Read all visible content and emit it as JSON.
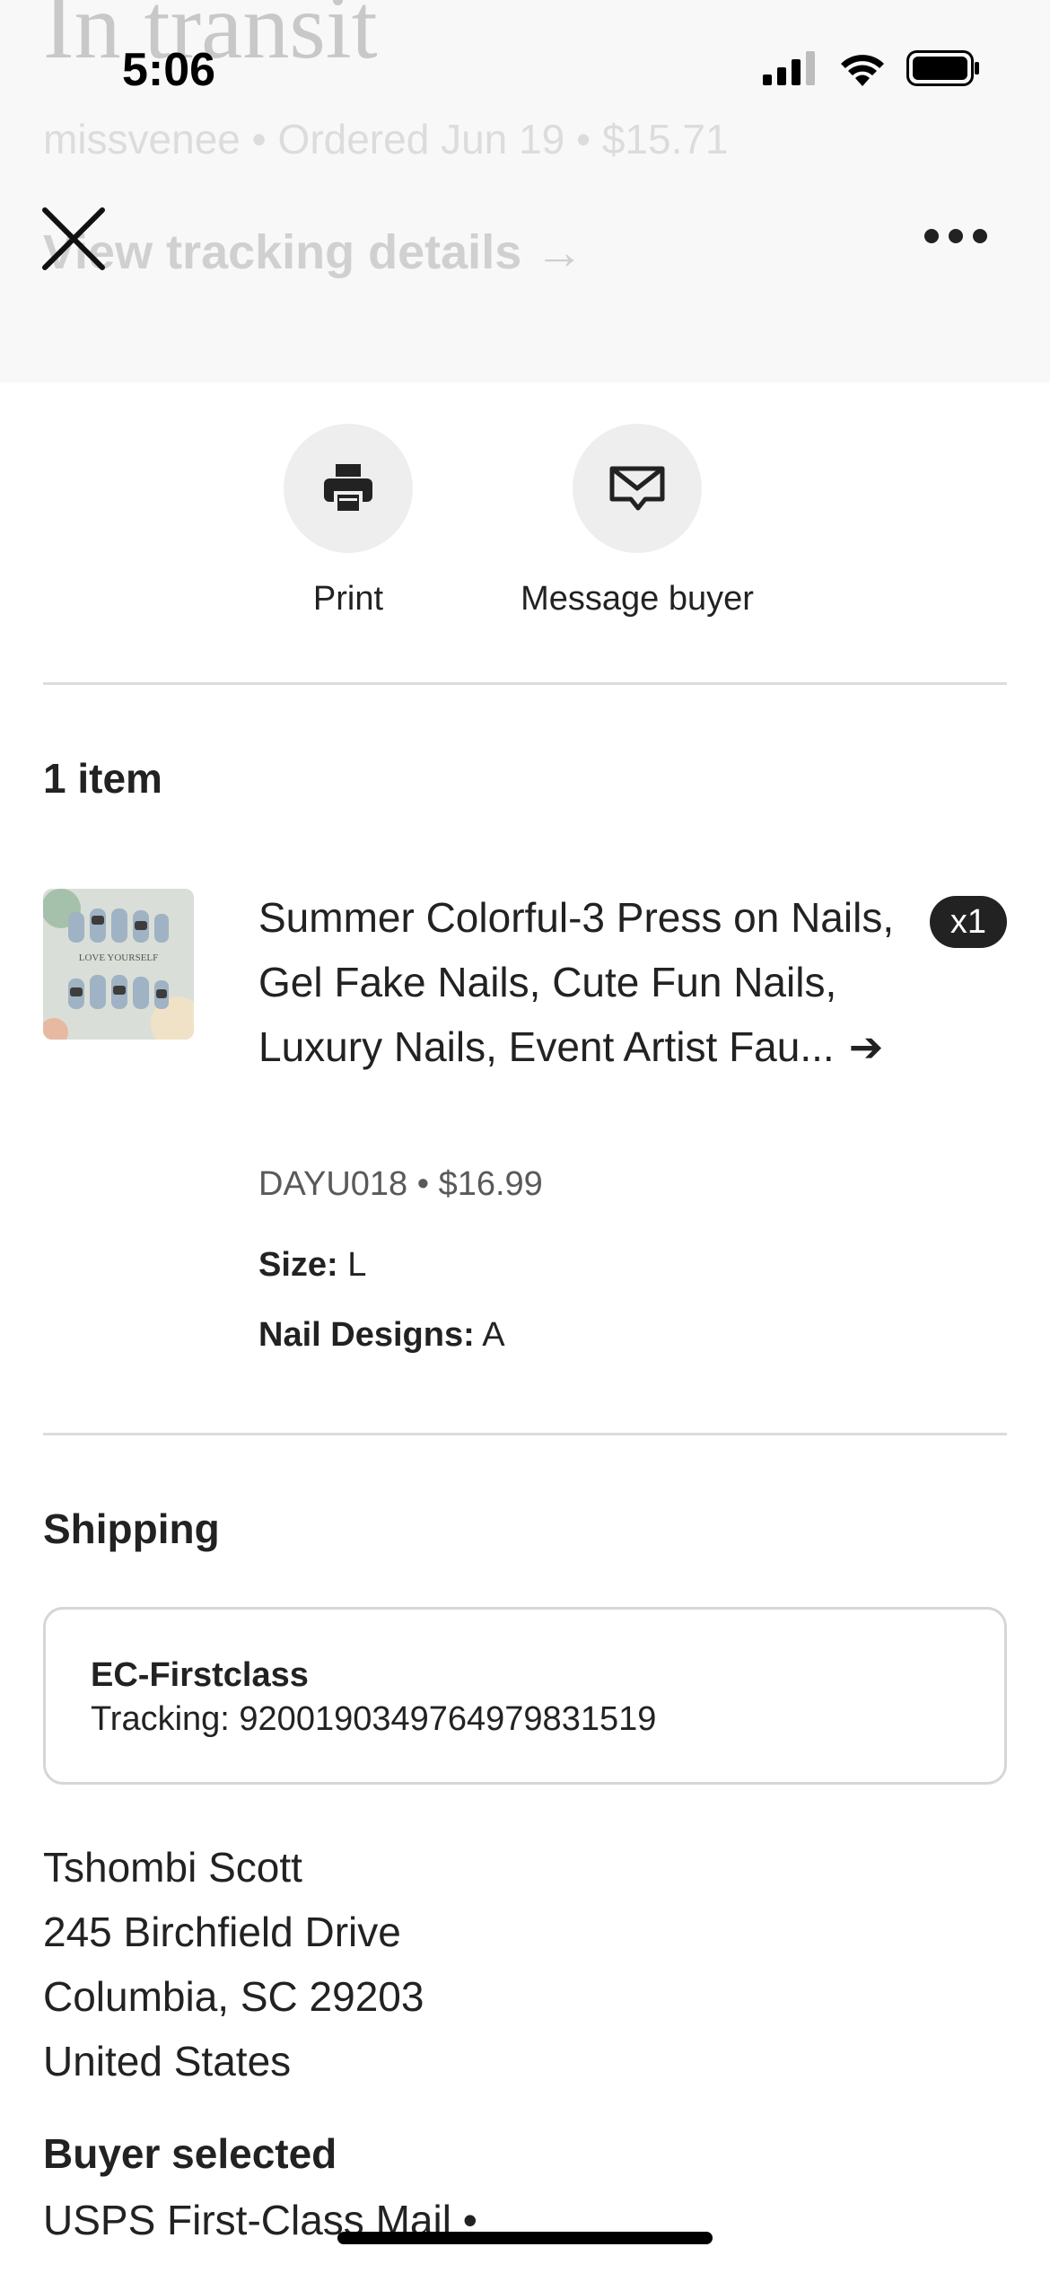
{
  "status_bar": {
    "time": "5:06"
  },
  "header": {
    "status_title": "In transit",
    "order_summary": "missvenee • Ordered Jun 19 • $15.71",
    "tracking_link": "View tracking details →"
  },
  "actions": {
    "print_label": "Print",
    "message_label": "Message buyer"
  },
  "items_section": {
    "heading": "1 item",
    "items": [
      {
        "title": "Summer Colorful-3 Press on Nails, Gel Fake Nails, Cute Fun Nails, Luxury Nails, Event Artist Fau...",
        "arrow": "➔",
        "quantity": "x1",
        "sku_price": "DAYU018 • $16.99",
        "size_label": "Size:",
        "size_value": "L",
        "design_label": "Nail Designs:",
        "design_value": "A",
        "thumbnail_text": "LOVE YOURSELF"
      }
    ]
  },
  "shipping": {
    "heading": "Shipping",
    "carrier": "EC-Firstclass",
    "tracking": "Tracking: 9200190349764979831519",
    "address": {
      "name": "Tshombi Scott",
      "street": "245 Birchfield Drive",
      "city_state_zip": "Columbia, SC 29203",
      "country": "United States"
    },
    "buyer_selected_label": "Buyer selected",
    "buyer_selected_method": "USPS First-Class Mail  •"
  },
  "icons": {
    "close": "close-icon",
    "more": "more-icon",
    "print": "printer-icon",
    "message": "envelope-icon",
    "signal": "cellular-signal-icon",
    "wifi": "wifi-icon",
    "battery": "battery-icon"
  },
  "colors": {
    "text": "#222222",
    "secondary_text": "#595959",
    "divider": "#dcdcdc",
    "action_circle": "#eeeeee",
    "badge": "#222222"
  }
}
